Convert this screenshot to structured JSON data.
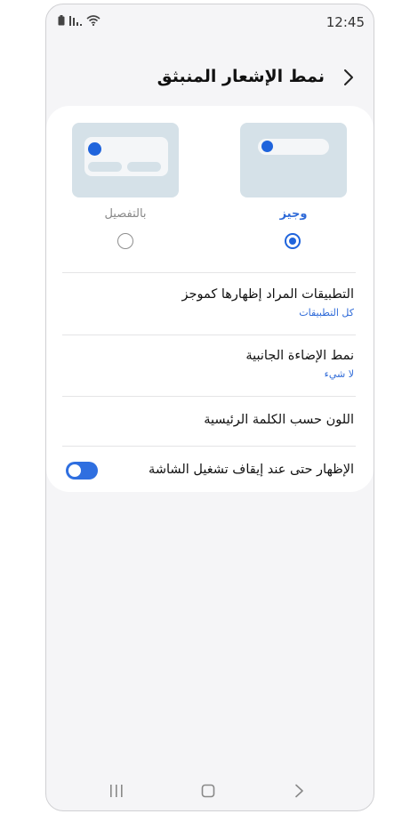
{
  "status_bar": {
    "time": "12:45"
  },
  "header": {
    "title": "نمط الإشعار المنبثق"
  },
  "style_options": {
    "brief": {
      "label": "وجيز",
      "selected": true
    },
    "detailed": {
      "label": "بالتفصيل",
      "selected": false
    }
  },
  "settings": {
    "apps_as_brief": {
      "title": "التطبيقات المراد إظهارها كموجز",
      "value": "كل التطبيقات"
    },
    "edge_lighting": {
      "title": "نمط الإضاءة الجانبية",
      "value": "لا شيء"
    },
    "keyword_color": {
      "title": "اللون حسب الكلمة الرئيسية"
    },
    "show_screen_off": {
      "title": "الإظهار حتى عند إيقاف تشغيل الشاشة",
      "enabled": true
    }
  },
  "colors": {
    "accent": "#1f64dc",
    "preview_bg": "#d5e1e8",
    "toggle_on": "#2f6fe0"
  }
}
